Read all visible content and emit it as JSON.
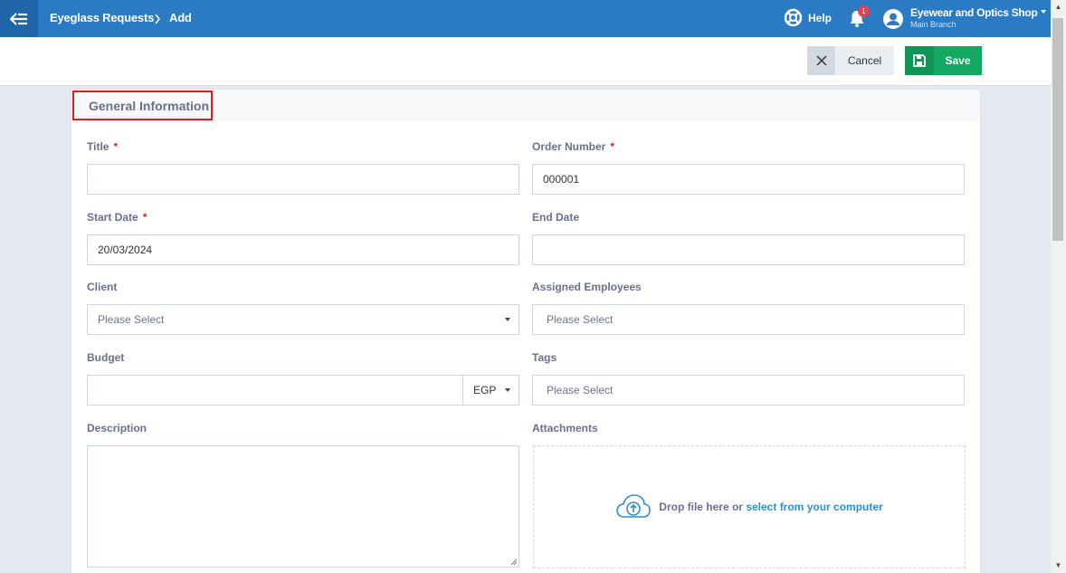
{
  "header": {
    "breadcrumb": [
      "Eyeglass Requests",
      "Add"
    ],
    "help_label": "Help",
    "notification_count": "1",
    "account_name": "Eyewear and Optics Shop",
    "account_branch": "Main Branch"
  },
  "toolbar": {
    "cancel_label": "Cancel",
    "save_label": "Save"
  },
  "form": {
    "section_title": "General Information",
    "title": {
      "label": "Title",
      "required": "*",
      "value": ""
    },
    "order_number": {
      "label": "Order Number",
      "required": "*",
      "value": "000001"
    },
    "start_date": {
      "label": "Start Date",
      "required": "*",
      "value": "20/03/2024"
    },
    "end_date": {
      "label": "End Date",
      "value": ""
    },
    "client": {
      "label": "Client",
      "placeholder": "Please Select"
    },
    "assigned_employees": {
      "label": "Assigned Employees",
      "placeholder": "Please Select"
    },
    "budget": {
      "label": "Budget",
      "value": "",
      "currency": "EGP"
    },
    "tags": {
      "label": "Tags",
      "placeholder": "Please Select"
    },
    "description": {
      "label": "Description",
      "value": ""
    },
    "attachments": {
      "label": "Attachments",
      "drop_text": "Drop file here or",
      "link_text": "select from your computer"
    }
  },
  "colors": {
    "topbar": "#2a7bc3",
    "save": "#13a862",
    "required": "#e21c24",
    "link": "#2a8fd4"
  },
  "icons": [
    "back-arrow-icon",
    "chevron-right-icon",
    "lifebuoy-icon",
    "bell-icon",
    "user-circle-icon",
    "caret-down-icon",
    "close-icon",
    "floppy-disk-icon",
    "cloud-upload-icon"
  ]
}
